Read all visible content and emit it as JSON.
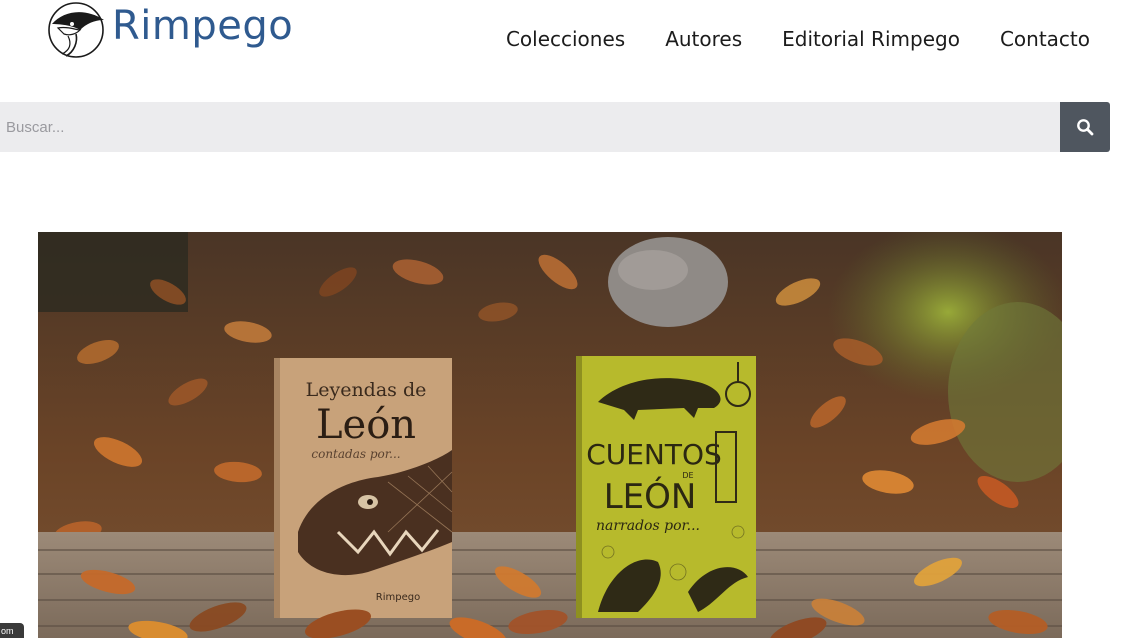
{
  "brand": {
    "name": "Rimpego",
    "color": "#2f5a8f"
  },
  "nav": {
    "items": [
      {
        "label": "Colecciones"
      },
      {
        "label": "Autores"
      },
      {
        "label": "Editorial Rimpego"
      },
      {
        "label": "Contacto"
      }
    ]
  },
  "search": {
    "placeholder": "Buscar...",
    "value": "",
    "icon": "search-icon"
  },
  "hero": {
    "books": [
      {
        "title_line1": "Leyendas de",
        "title_line2": "León",
        "subtitle": "contadas por...",
        "publisher": "Rimpego"
      },
      {
        "title_line1": "CUENTOS",
        "title_de": "DE",
        "title_line2": "LEÓN",
        "subtitle": "narrados por..."
      }
    ]
  },
  "side_tab": {
    "label": "om"
  }
}
